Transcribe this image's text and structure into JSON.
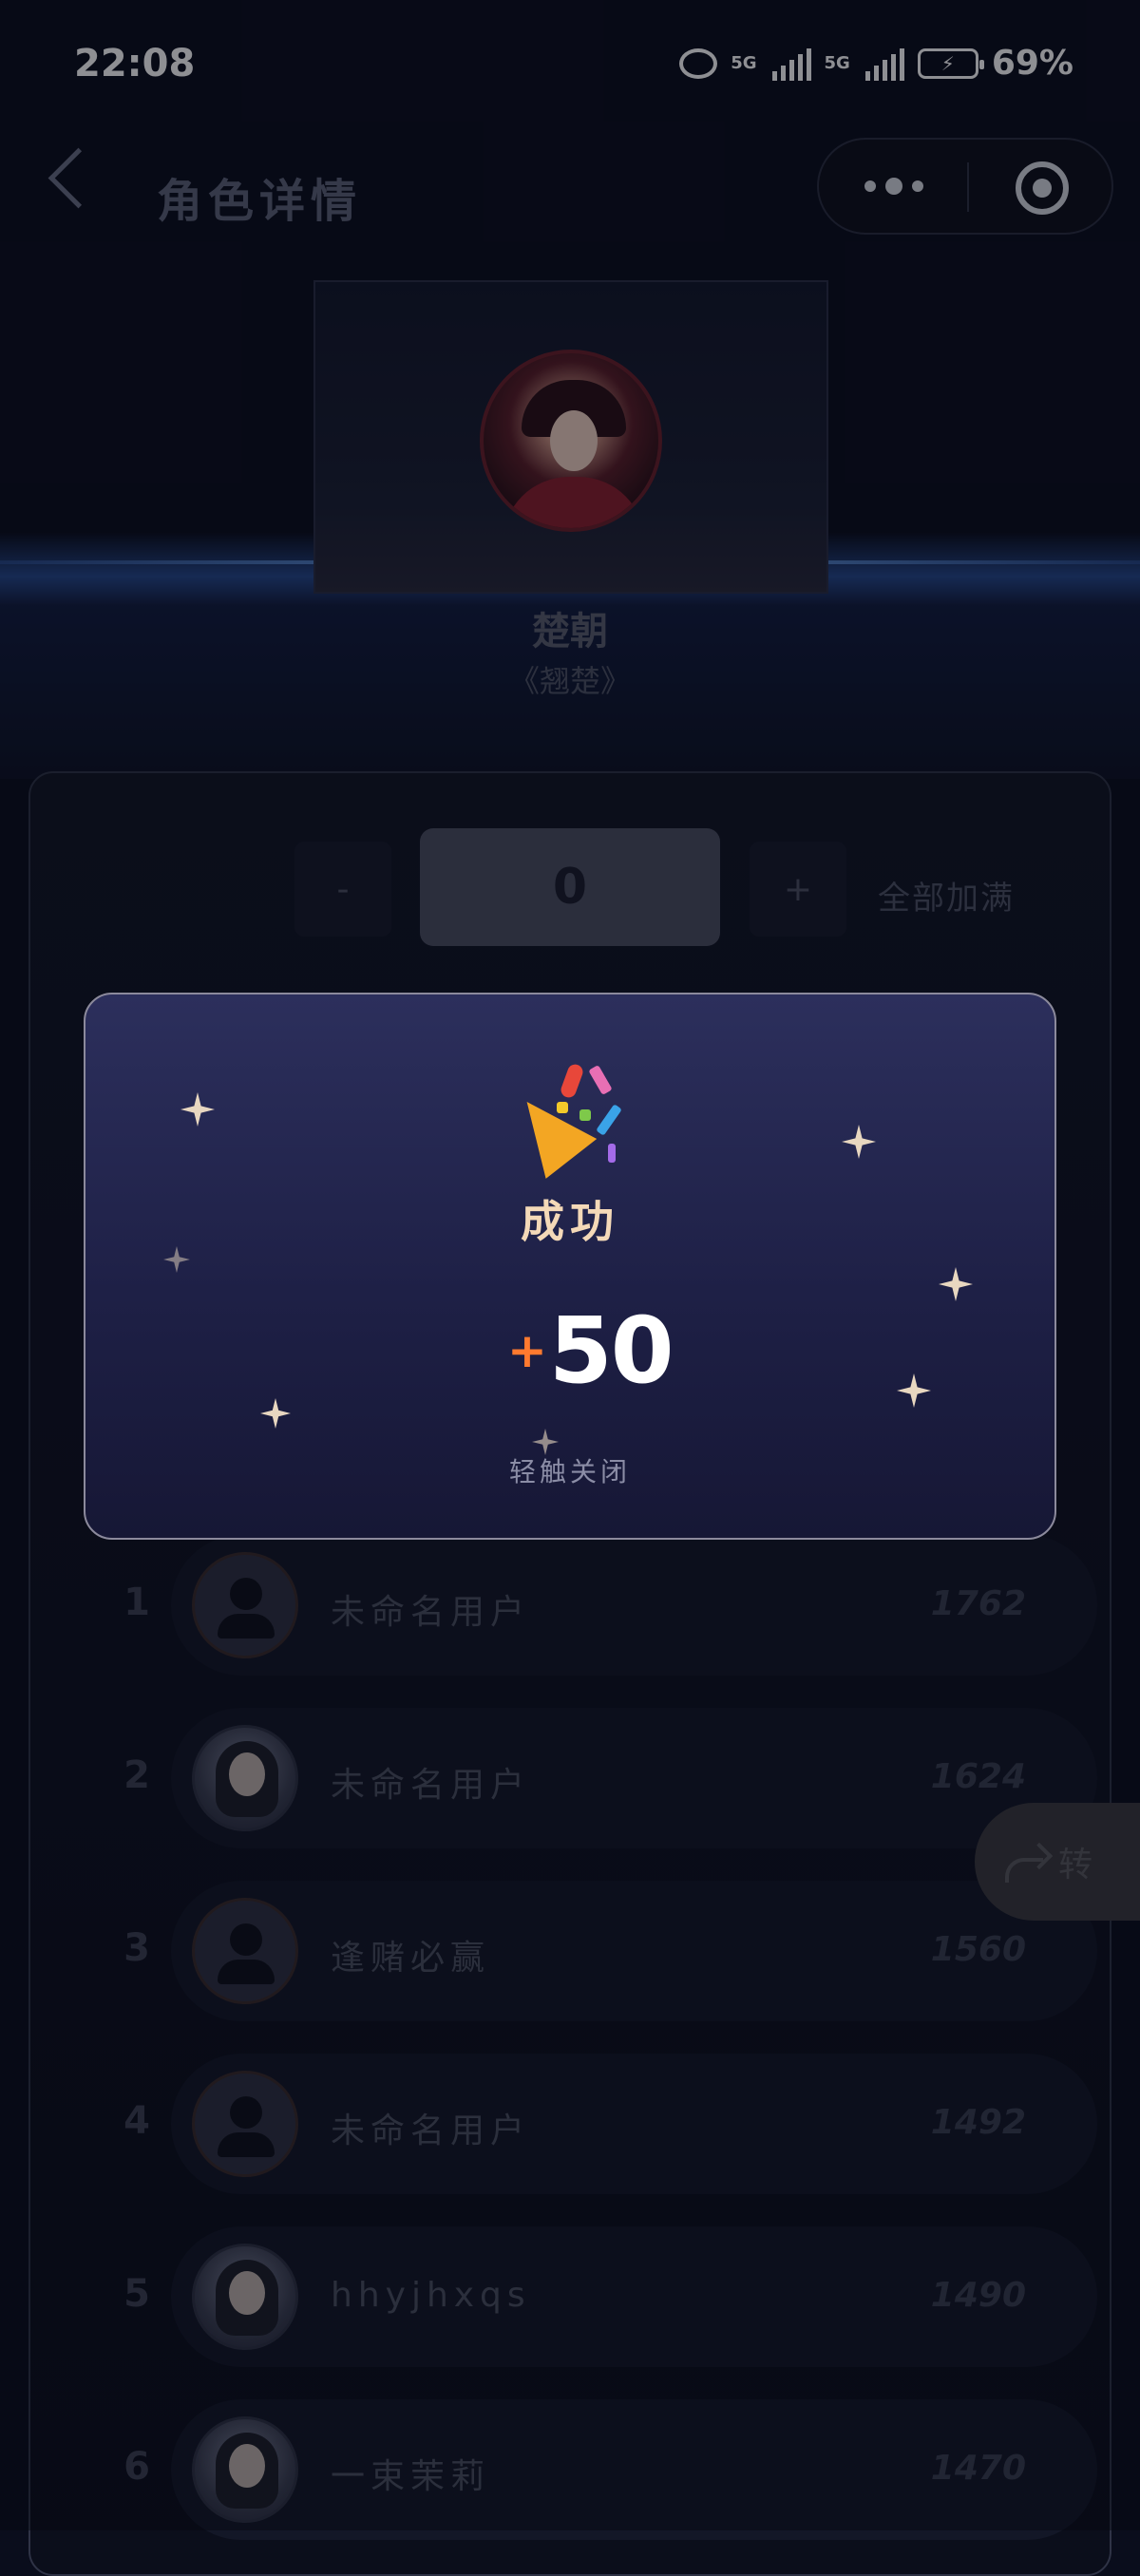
{
  "status_bar": {
    "time": "22:08",
    "network1": "5G",
    "network2": "5G",
    "battery": "69%"
  },
  "nav": {
    "title": "角色详情"
  },
  "character": {
    "name": "楚朝",
    "work": "《翘楚》"
  },
  "quantity": {
    "minus_label": "-",
    "value": "0",
    "plus_label": "+",
    "fill_all_label": "全部加满"
  },
  "ranking": [
    {
      "rank": "1",
      "name": "未命名用户",
      "score": "1762",
      "avatar": "default"
    },
    {
      "rank": "2",
      "name": "未命名用户",
      "score": "1624",
      "avatar": "photo"
    },
    {
      "rank": "3",
      "name": "逢赌必赢",
      "score": "1560",
      "avatar": "default"
    },
    {
      "rank": "4",
      "name": "未命名用户",
      "score": "1492",
      "avatar": "default"
    },
    {
      "rank": "5",
      "name": "hhyjhxqs",
      "score": "1490",
      "avatar": "photo"
    },
    {
      "rank": "6",
      "name": "一束茉莉",
      "score": "1470",
      "avatar": "photo"
    }
  ],
  "share": {
    "label": "转"
  },
  "modal": {
    "title": "成功",
    "plus_sign": "+",
    "points": "50",
    "close_hint": "轻触关闭"
  },
  "colors": {
    "background": "#0a0d1c",
    "modal_top": "#2c2f5c",
    "modal_bottom": "#161735",
    "points_plus": "#ff7a2f",
    "title_text": "#f4d9b8"
  }
}
